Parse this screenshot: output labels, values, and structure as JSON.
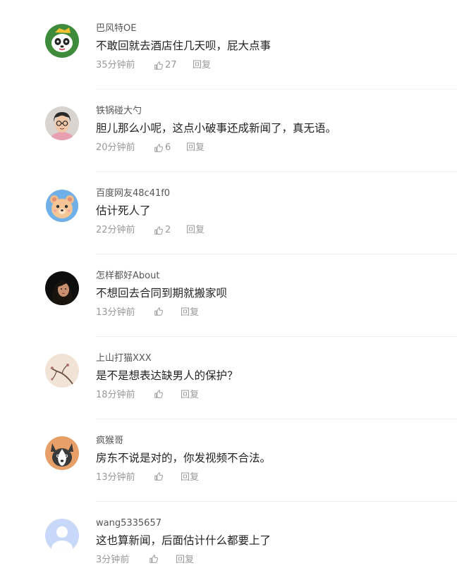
{
  "colors": {
    "username": "#555555",
    "content": "#222222",
    "meta": "#999999",
    "divider": "#eeeeee"
  },
  "comments": [
    {
      "username": "巴风特OE",
      "text": "不敢回就去酒店住几天呗，屁大点事",
      "time": "35分钟前",
      "likes": "27",
      "reply": "回复",
      "avatar": "panda-avatar-icon"
    },
    {
      "username": "铁锅碰大勺",
      "text": "胆儿那么小呢，这点小破事还成新闻了，真无语。",
      "time": "20分钟前",
      "likes": "6",
      "reply": "回复",
      "avatar": "glasses-person-avatar-icon"
    },
    {
      "username": "百度网友48c41f0",
      "text": "估计死人了",
      "time": "22分钟前",
      "likes": "2",
      "reply": "回复",
      "avatar": "bear-avatar-icon"
    },
    {
      "username": "怎样都好About",
      "text": "不想回去合同到期就搬家呗",
      "time": "13分钟前",
      "likes": "",
      "reply": "回复",
      "avatar": "woman-avatar-icon"
    },
    {
      "username": "上山打猫XXX",
      "text": "是不是想表达缺男人的保护？",
      "time": "18分钟前",
      "likes": "",
      "reply": "回复",
      "avatar": "branch-avatar-icon"
    },
    {
      "username": "疯猴哥",
      "text": "房东不说是对的，你发视频不合法。",
      "time": "13分钟前",
      "likes": "",
      "reply": "回复",
      "avatar": "husky-avatar-icon"
    },
    {
      "username": "wang5335657",
      "text": "这也算新闻，后面估计什么都要上了",
      "time": "3分钟前",
      "likes": "",
      "reply": "回复",
      "avatar": "default-avatar-icon"
    }
  ]
}
